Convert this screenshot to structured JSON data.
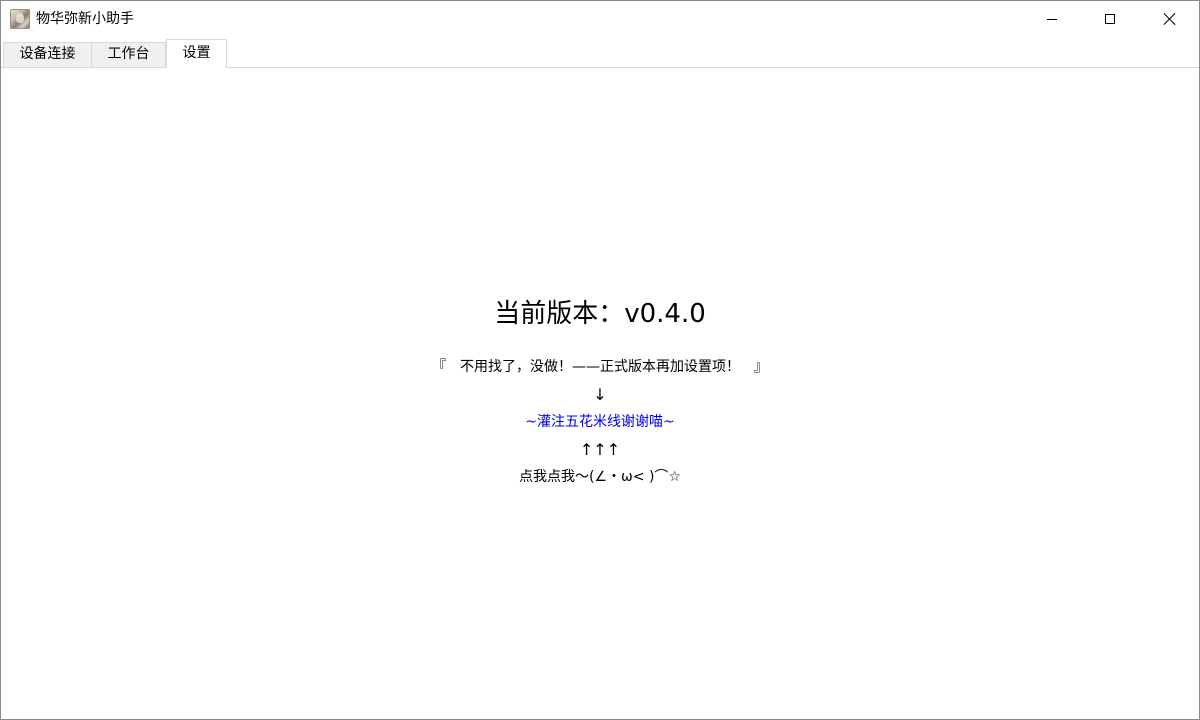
{
  "window": {
    "title": "物华弥新小助手",
    "app_icon": "app-portrait-icon",
    "controls": {
      "minimize_icon": "minimize-icon",
      "maximize_icon": "maximize-icon",
      "close_icon": "close-icon"
    }
  },
  "tabs": [
    {
      "label": "设备连接",
      "active": false
    },
    {
      "label": "工作台",
      "active": false
    },
    {
      "label": "设置",
      "active": true
    }
  ],
  "settings": {
    "version_text": "当前版本：v0.4.0",
    "notice": "『　不用找了，没做！——正式版本再加设置项！　』",
    "arrow_down": "↓",
    "donate_link": "~灌注五花米线谢谢喵~",
    "arrows_up": "↑↑↑",
    "click_me": "点我点我～(∠・ω< )⌒☆"
  },
  "colors": {
    "link": "#0000ee",
    "active_tab_bg": "#ffffff",
    "inactive_tab_bg": "#f0f0f0",
    "border": "#d9d9d9"
  }
}
